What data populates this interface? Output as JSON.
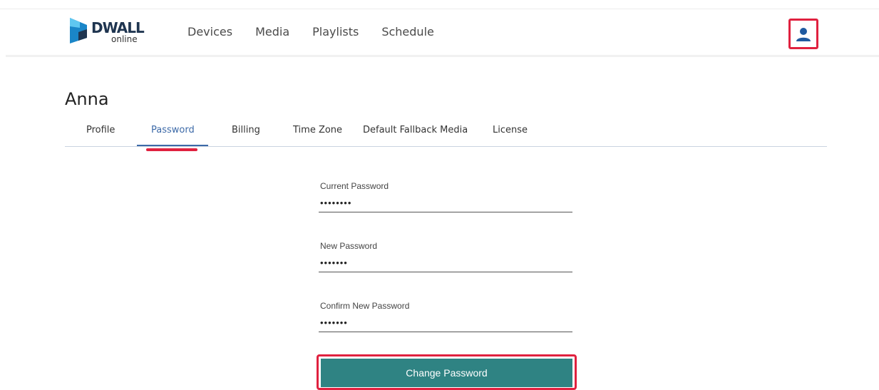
{
  "brand": {
    "name": "DWALL",
    "sub": "online"
  },
  "nav": {
    "items": [
      "Devices",
      "Media",
      "Playlists",
      "Schedule"
    ]
  },
  "user_icon": "user-icon",
  "page": {
    "title": "Anna"
  },
  "tabs": [
    "Profile",
    "Password",
    "Billing",
    "Time Zone",
    "Default Fallback Media",
    "License"
  ],
  "active_tab": "Password",
  "form": {
    "current": {
      "label": "Current Password",
      "value": "••••••••"
    },
    "new": {
      "label": "New Password",
      "value": "•••••••"
    },
    "confirm": {
      "label": "Confirm New Password",
      "value": "•••••••"
    },
    "submit_label": "Change Password"
  },
  "colors": {
    "accent": "#3d6aa8",
    "highlight": "#e0213f",
    "button": "#2f8383",
    "brand_blue": "#1a86c8"
  }
}
